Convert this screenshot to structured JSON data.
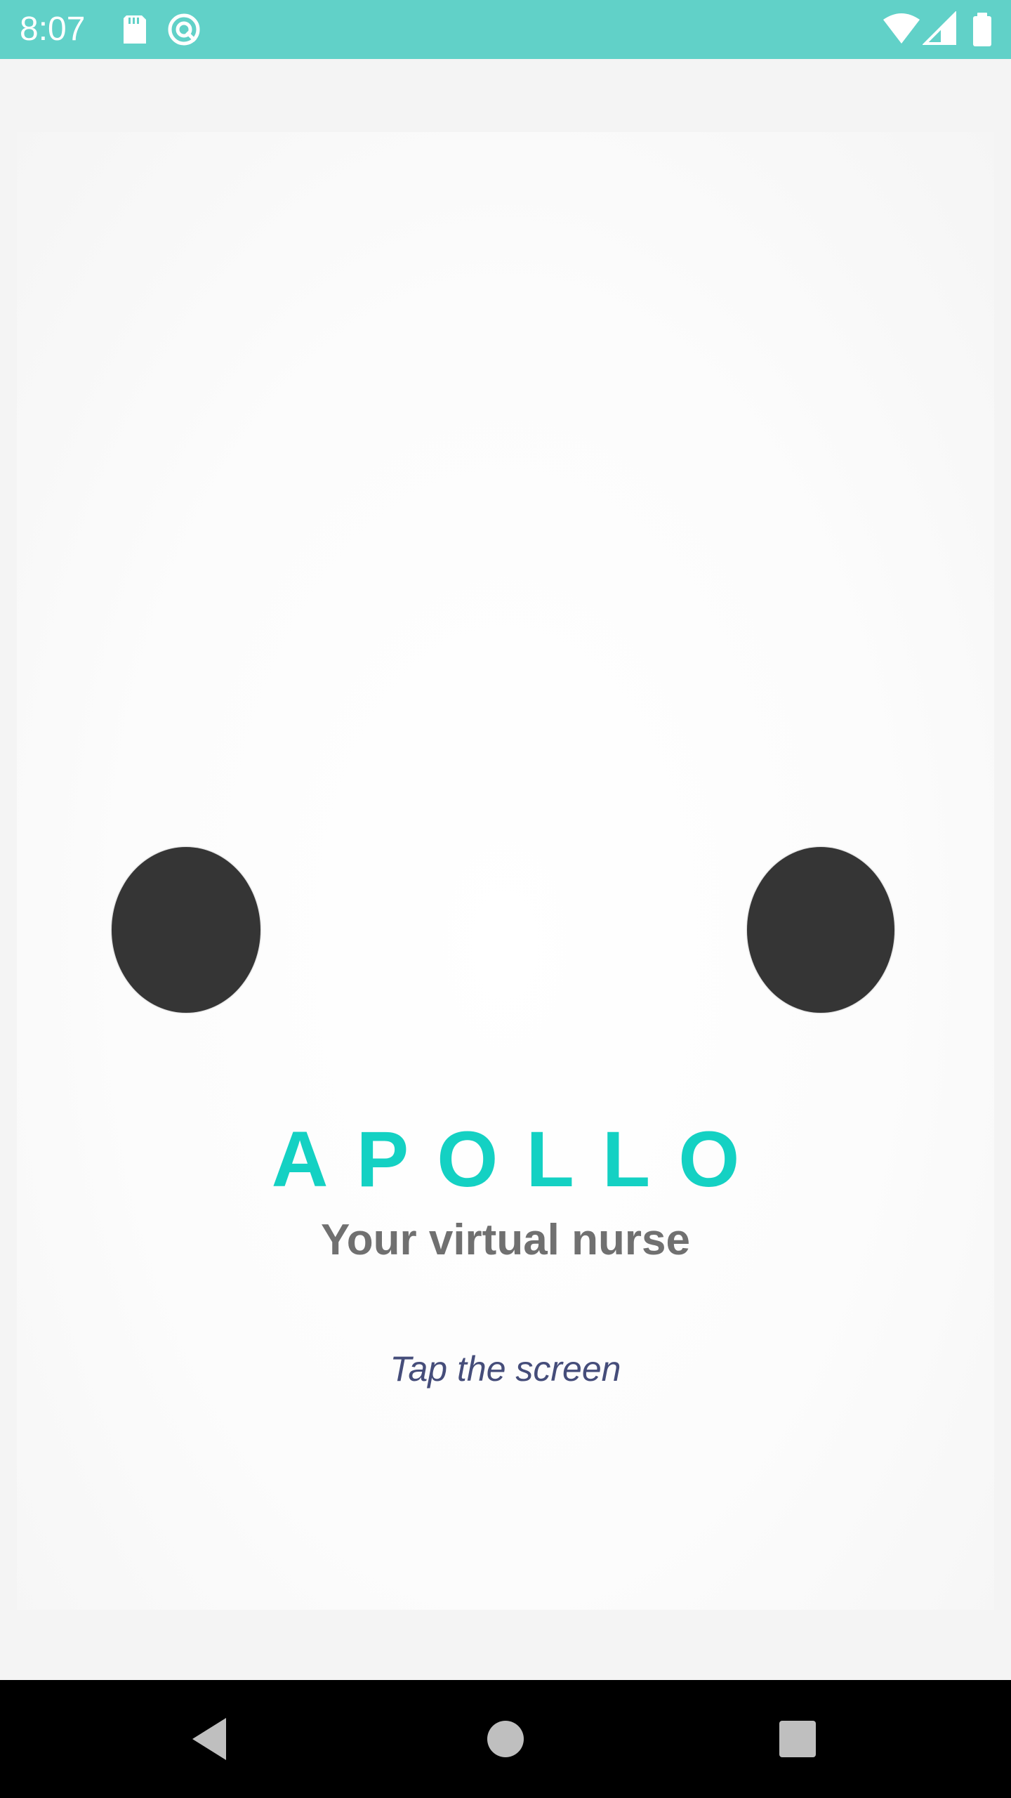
{
  "status_bar": {
    "time": "8:07",
    "background_color": "#61d1c8",
    "icons": [
      "sd-card-icon",
      "sync-icon",
      "wifi-icon",
      "cell-signal-icon",
      "battery-icon"
    ]
  },
  "app": {
    "title": "APOLLO",
    "subtitle": "Your virtual nurse",
    "hint": "Tap the screen",
    "title_color": "#14d1c3",
    "subtitle_color": "#707070",
    "hint_color": "#454d7a",
    "eye_color": "#353535"
  },
  "navigation_bar": {
    "buttons": [
      "back-icon",
      "home-icon",
      "recents-icon"
    ]
  }
}
